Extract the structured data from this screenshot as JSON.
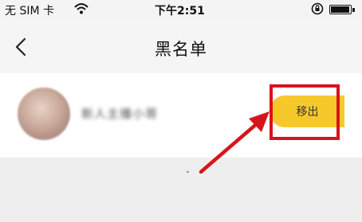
{
  "status_bar": {
    "carrier": "无 SIM 卡",
    "time": "下午2:51",
    "battery_level": 0.95
  },
  "nav": {
    "title": "黑名单"
  },
  "blacklist": [
    {
      "username": "新人主播小哥",
      "remove_label": "移出"
    }
  ],
  "colors": {
    "accent": "#f6c82c",
    "highlight": "#d7141c"
  },
  "icons": [
    "wifi-icon",
    "orientation-lock-icon",
    "battery-icon",
    "back-chevron-icon",
    "arrow-icon"
  ]
}
